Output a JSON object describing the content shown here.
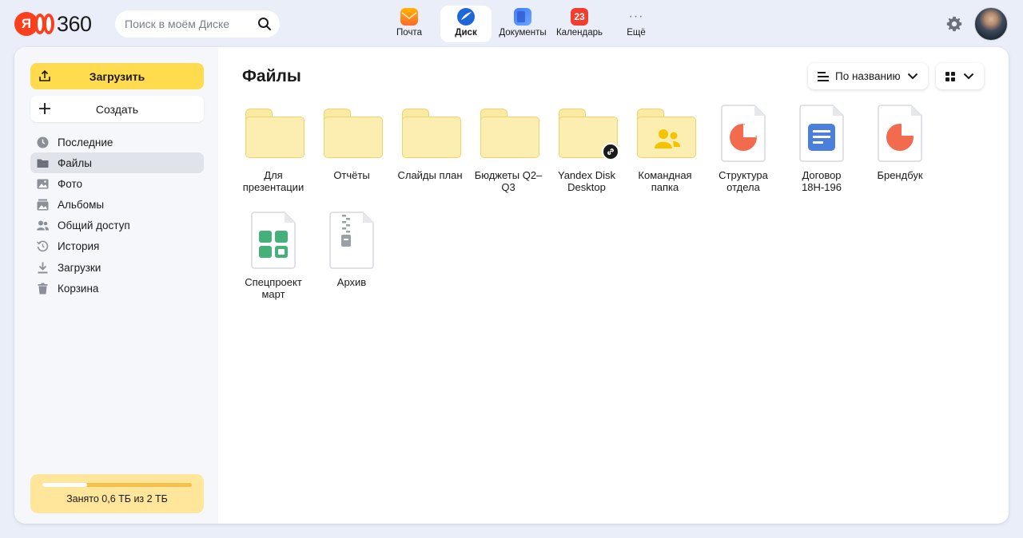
{
  "logo": {
    "ya": "Я",
    "text": "360"
  },
  "search": {
    "placeholder": "Поиск в моём Диске"
  },
  "apps": [
    {
      "label": "Почта",
      "icon": "mail-icon",
      "active": false
    },
    {
      "label": "Диск",
      "icon": "disk-icon",
      "active": true
    },
    {
      "label": "Документы",
      "icon": "documents-icon",
      "active": false
    },
    {
      "label": "Календарь",
      "icon": "calendar-icon",
      "badge": "23",
      "active": false
    },
    {
      "label": "Ещё",
      "icon": "more-icon",
      "active": false
    }
  ],
  "sidebar": {
    "upload_label": "Загрузить",
    "create_label": "Создать",
    "items": [
      {
        "label": "Последние",
        "icon": "clock-icon"
      },
      {
        "label": "Файлы",
        "icon": "folder-icon",
        "active": true
      },
      {
        "label": "Фото",
        "icon": "photo-icon"
      },
      {
        "label": "Альбомы",
        "icon": "albums-icon"
      },
      {
        "label": "Общий доступ",
        "icon": "shared-icon"
      },
      {
        "label": "История",
        "icon": "history-icon"
      },
      {
        "label": "Загрузки",
        "icon": "download-icon"
      },
      {
        "label": "Корзина",
        "icon": "trash-icon"
      }
    ],
    "storage": {
      "text": "Занято 0,6 ТБ из 2 ТБ",
      "used_fraction": 0.3
    }
  },
  "main": {
    "title": "Файлы",
    "sort_label": "По названию",
    "items": [
      {
        "name": "Для презентации",
        "kind": "folder"
      },
      {
        "name": "Отчёты",
        "kind": "folder"
      },
      {
        "name": "Слайды план",
        "kind": "folder"
      },
      {
        "name": "Бюджеты Q2–Q3",
        "kind": "folder"
      },
      {
        "name": "Yandex Disk Desktop",
        "kind": "folder-link"
      },
      {
        "name": "Командная папка",
        "kind": "folder-shared"
      },
      {
        "name": "Структура отдела",
        "kind": "presentation"
      },
      {
        "name": "Договор 18Н-196",
        "kind": "document"
      },
      {
        "name": "Брендбук",
        "kind": "presentation"
      },
      {
        "name": "Спецпроект март",
        "kind": "spreadsheet"
      },
      {
        "name": "Архив",
        "kind": "archive"
      }
    ]
  },
  "colors": {
    "accent_yellow": "#ffdb4d",
    "folder_fill": "#fbeeb0",
    "presentation": "#f26b4f",
    "document": "#4a7fdc",
    "spreadsheet": "#46b07a"
  }
}
